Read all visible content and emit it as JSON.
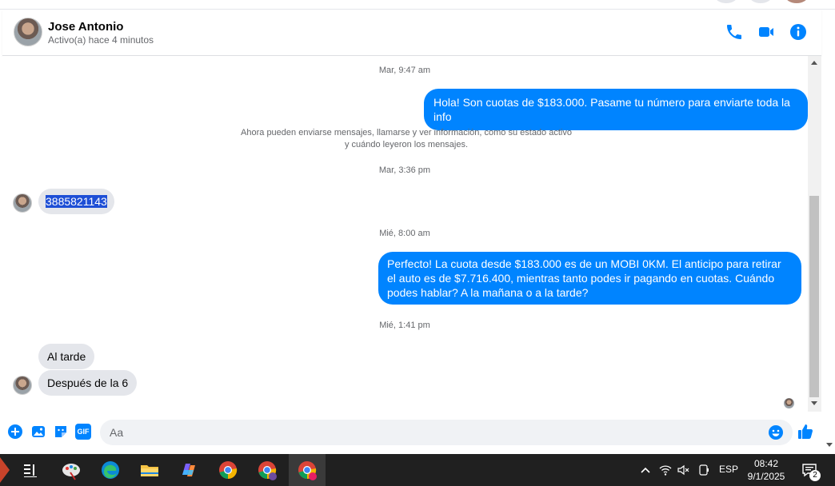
{
  "contact": {
    "name": "Jose Antonio",
    "status": "Activo(a) hace 4 minutos"
  },
  "header_icons": [
    "phone-icon",
    "video-call-icon",
    "info-icon"
  ],
  "colors": {
    "accent": "#0084ff",
    "incoming_bubble": "#e4e6eb",
    "taskbar": "#202020"
  },
  "messages": {
    "ts1": "Mar, 9:47 am",
    "out1": "Hola! Son cuotas de $183.000. Pasame tu número para enviarte toda la info",
    "system_line1": "Ahora pueden enviarse mensajes, llamarse y ver información, como su estado activo",
    "system_line2": "y cuándo leyeron los mensajes.",
    "ts2": "Mar, 3:36 pm",
    "in1": "3885821143",
    "ts3": "Mié, 8:00 am",
    "out2": "Perfecto! La cuota desde $183.000 es de un MOBI 0KM. El anticipo para retirar el auto es de $7.716.400, mientras tanto podes ir pagando en cuotas. Cuándo podes hablar? A la mañana o a la tarde?",
    "ts4": "Mié, 1:41 pm",
    "in2": "Al tarde",
    "in3": "Después de la 6"
  },
  "composer": {
    "placeholder": "Aa",
    "icons": [
      "plus-icon",
      "photo-icon",
      "sticker-icon",
      "gif-icon",
      "emoji-icon",
      "like-icon"
    ],
    "gif_label": "GIF"
  },
  "taskbar": {
    "language": "ESP",
    "time": "08:42",
    "date": "9/1/2025",
    "notifications": "2"
  }
}
